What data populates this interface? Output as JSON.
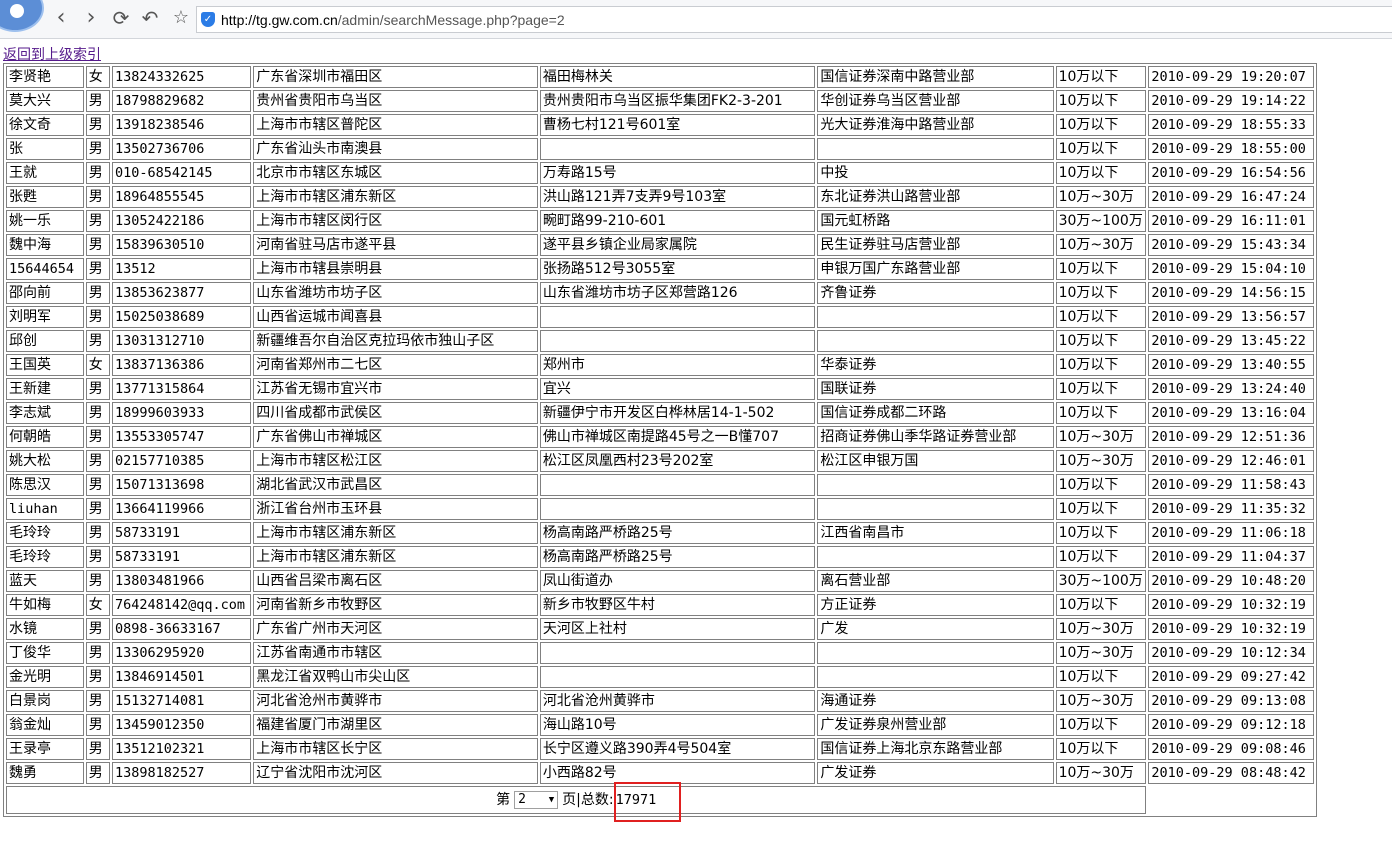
{
  "browser": {
    "url_host": "http://tg.gw.com.cn",
    "url_path": "/admin/searchMessage.php?page=2"
  },
  "page": {
    "back_link": "返回到上级索引",
    "pager": {
      "prefix": "第",
      "selected_page": "2",
      "suffix": "页|总数:",
      "total": "17971"
    }
  },
  "rows": [
    [
      "李贤艳",
      "女",
      "13824332625",
      "广东省深圳市福田区",
      "福田梅林关",
      "国信证券深南中路营业部",
      "10万以下",
      "2010-09-29 19:20:07"
    ],
    [
      "莫大兴",
      "男",
      "18798829682",
      "贵州省贵阳市乌当区",
      "贵州贵阳市乌当区振华集团FK2-3-201",
      "华创证券乌当区营业部",
      "10万以下",
      "2010-09-29 19:14:22"
    ],
    [
      "徐文奇",
      "男",
      "13918238546",
      "上海市市辖区普陀区",
      "曹杨七村121号601室",
      "光大证券淮海中路营业部",
      "10万以下",
      "2010-09-29 18:55:33"
    ],
    [
      "张",
      "男",
      "13502736706",
      "广东省汕头市南澳县",
      "",
      "",
      "10万以下",
      "2010-09-29 18:55:00"
    ],
    [
      "王就",
      "男",
      "010-68542145",
      "北京市市辖区东城区",
      "万寿路15号",
      "中投",
      "10万以下",
      "2010-09-29 16:54:56"
    ],
    [
      "张甦",
      "男",
      "18964855545",
      "上海市市辖区浦东新区",
      "洪山路121弄7支弄9号103室",
      "东北证券洪山路营业部",
      "10万~30万",
      "2010-09-29 16:47:24"
    ],
    [
      "姚一乐",
      "男",
      "13052422186",
      "上海市市辖区闵行区",
      "畹町路99-210-601",
      "国元虹桥路",
      "30万~100万",
      "2010-09-29 16:11:01"
    ],
    [
      "魏中海",
      "男",
      "15839630510",
      "河南省驻马店市遂平县",
      "遂平县乡镇企业局家属院",
      "民生证券驻马店营业部",
      "10万~30万",
      "2010-09-29 15:43:34"
    ],
    [
      "15644654",
      "男",
      "13512",
      "上海市市辖县崇明县",
      "张扬路512号3055室",
      "申银万国广东路营业部",
      "10万以下",
      "2010-09-29 15:04:10"
    ],
    [
      "邵向前",
      "男",
      "13853623877",
      "山东省潍坊市坊子区",
      "山东省潍坊市坊子区郑营路126",
      "齐鲁证券",
      "10万以下",
      "2010-09-29 14:56:15"
    ],
    [
      "刘明军",
      "男",
      "15025038689",
      "山西省运城市闻喜县",
      "",
      "",
      "10万以下",
      "2010-09-29 13:56:57"
    ],
    [
      "邱创",
      "男",
      "13031312710",
      "新疆维吾尔自治区克拉玛依市独山子区",
      "",
      "",
      "10万以下",
      "2010-09-29 13:45:22"
    ],
    [
      "王国英",
      "女",
      "13837136386",
      "河南省郑州市二七区",
      "郑州市",
      "华泰证券",
      "10万以下",
      "2010-09-29 13:40:55"
    ],
    [
      "王新建",
      "男",
      "13771315864",
      "江苏省无锡市宜兴市",
      "宜兴",
      "国联证券",
      "10万以下",
      "2010-09-29 13:24:40"
    ],
    [
      "李志斌",
      "男",
      "18999603933",
      "四川省成都市武侯区",
      "新疆伊宁市开发区白桦林居14-1-502",
      "国信证券成都二环路",
      "10万以下",
      "2010-09-29 13:16:04"
    ],
    [
      "何朝皓",
      "男",
      "13553305747",
      "广东省佛山市禅城区",
      "佛山市禅城区南提路45号之一B懂707",
      "招商证券佛山季华路证券营业部",
      "10万~30万",
      "2010-09-29 12:51:36"
    ],
    [
      "姚大松",
      "男",
      "02157710385",
      "上海市市辖区松江区",
      "松江区凤凰西村23号202室",
      "松江区申银万国",
      "10万~30万",
      "2010-09-29 12:46:01"
    ],
    [
      "陈思汉",
      "男",
      "15071313698",
      "湖北省武汉市武昌区",
      "",
      "",
      "10万以下",
      "2010-09-29 11:58:43"
    ],
    [
      "liuhan",
      "男",
      "13664119966",
      "浙江省台州市玉环县",
      "",
      "",
      "10万以下",
      "2010-09-29 11:35:32"
    ],
    [
      "毛玲玲",
      "男",
      "58733191",
      "上海市市辖区浦东新区",
      "杨高南路严桥路25号",
      "江西省南昌市",
      "10万以下",
      "2010-09-29 11:06:18"
    ],
    [
      "毛玲玲",
      "男",
      "58733191",
      "上海市市辖区浦东新区",
      "杨高南路严桥路25号",
      "",
      "10万以下",
      "2010-09-29 11:04:37"
    ],
    [
      "蓝天",
      "男",
      "13803481966",
      "山西省吕梁市离石区",
      "凤山街道办",
      "离石营业部",
      "30万~100万",
      "2010-09-29 10:48:20"
    ],
    [
      "牛如梅",
      "女",
      "764248142@qq.com",
      "河南省新乡市牧野区",
      "新乡市牧野区牛村",
      "方正证券",
      "10万以下",
      "2010-09-29 10:32:19"
    ],
    [
      "水镜",
      "男",
      "0898-36633167",
      "广东省广州市天河区",
      "天河区上社村",
      "广发",
      "10万~30万",
      "2010-09-29 10:32:19"
    ],
    [
      "丁俊华",
      "男",
      "13306295920",
      "江苏省南通市市辖区",
      "",
      "",
      "10万~30万",
      "2010-09-29 10:12:34"
    ],
    [
      "金光明",
      "男",
      "13846914501",
      "黑龙江省双鸭山市尖山区",
      "",
      "",
      "10万以下",
      "2010-09-29 09:27:42"
    ],
    [
      "白景岗",
      "男",
      "15132714081",
      "河北省沧州市黄骅市",
      "河北省沧州黄骅市",
      "海通证券",
      "10万~30万",
      "2010-09-29 09:13:08"
    ],
    [
      "翁金灿",
      "男",
      "13459012350",
      "福建省厦门市湖里区",
      "海山路10号",
      "广发证券泉州营业部",
      "10万以下",
      "2010-09-29 09:12:18"
    ],
    [
      "王录亭",
      "男",
      "13512102321",
      "上海市市辖区长宁区",
      "长宁区遵义路390弄4号504室",
      "国信证券上海北京东路营业部",
      "10万以下",
      "2010-09-29 09:08:46"
    ],
    [
      "魏勇",
      "男",
      "13898182527",
      "辽宁省沈阳市沈河区",
      "小西路82号",
      "广发证券",
      "10万~30万",
      "2010-09-29 08:48:42"
    ]
  ]
}
